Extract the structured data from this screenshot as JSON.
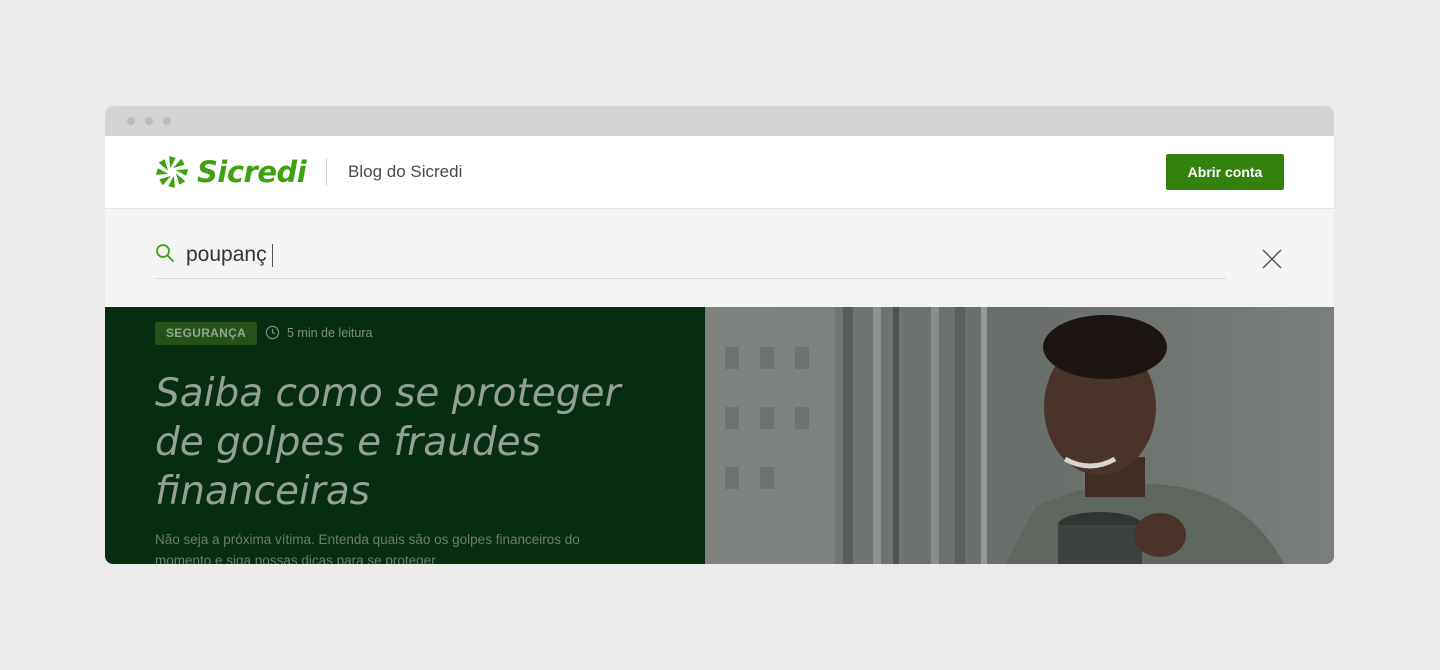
{
  "header": {
    "brand": "Sicredi",
    "blog_title": "Blog do Sicredi",
    "cta_label": "Abrir conta"
  },
  "search": {
    "value": "poupanç"
  },
  "hero": {
    "tag": "SEGURANÇA",
    "read_time": "5 min de leitura",
    "title": "Saiba como se proteger de golpes e fraudes financeiras",
    "description": "Não seja a próxima vítima. Entenda quais são os golpes financeiros do momento e siga nossas dicas para se proteger"
  },
  "colors": {
    "brand_green": "#3fa110",
    "button_green": "#33820d",
    "hero_bg": "#072d10"
  },
  "icons": [
    "sicredi-logo-icon",
    "search-icon",
    "close-icon",
    "clock-icon"
  ]
}
